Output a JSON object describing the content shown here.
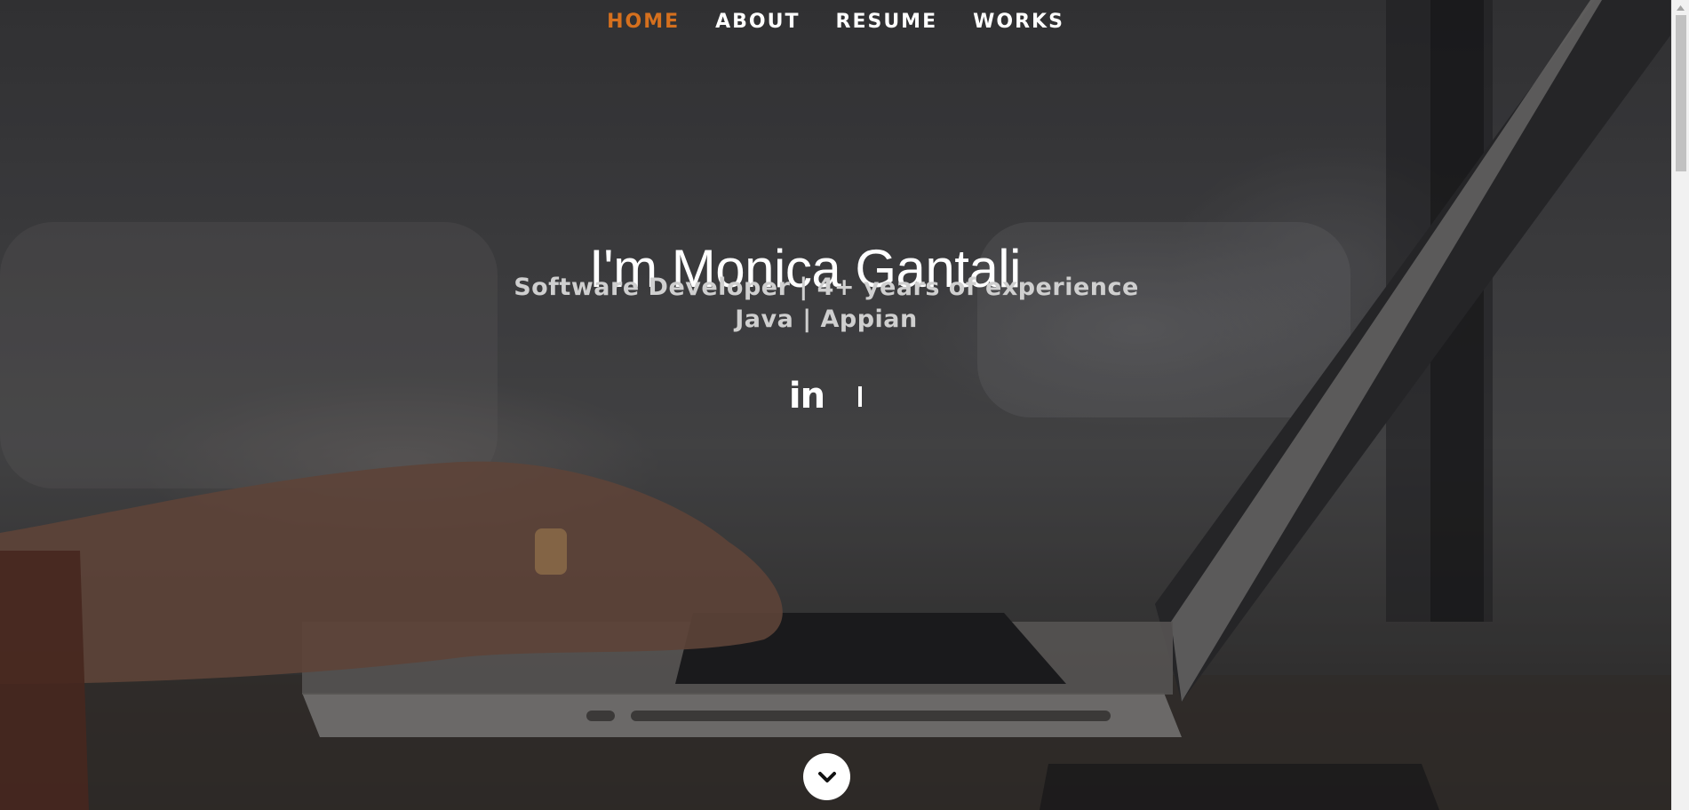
{
  "nav": {
    "items": [
      {
        "label": "HOME",
        "active": true
      },
      {
        "label": "ABOUT",
        "active": false
      },
      {
        "label": "RESUME",
        "active": false
      },
      {
        "label": "WORKS",
        "active": false
      }
    ],
    "active_color": "#d5701e"
  },
  "banner": {
    "title": "I'm Monica Gantali",
    "subtitle_line1": "Software Developer | 4+ years of experience",
    "subtitle_line2": "Java | Appian"
  },
  "social": {
    "linkedin_label": "in",
    "items": [
      "linkedin-icon",
      "github-icon"
    ]
  },
  "scroll": {
    "icon": "chevron-down-icon"
  }
}
